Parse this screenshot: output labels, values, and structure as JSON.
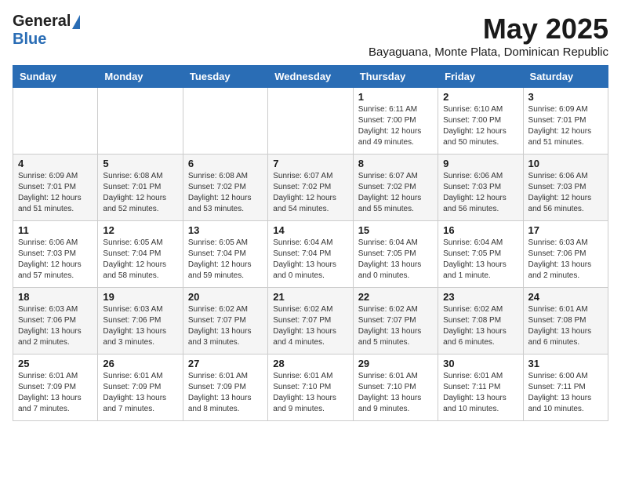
{
  "header": {
    "logo_general": "General",
    "logo_blue": "Blue",
    "title": "May 2025",
    "subtitle": "Bayaguana, Monte Plata, Dominican Republic"
  },
  "days_of_week": [
    "Sunday",
    "Monday",
    "Tuesday",
    "Wednesday",
    "Thursday",
    "Friday",
    "Saturday"
  ],
  "weeks": [
    [
      {
        "day": "",
        "info": ""
      },
      {
        "day": "",
        "info": ""
      },
      {
        "day": "",
        "info": ""
      },
      {
        "day": "",
        "info": ""
      },
      {
        "day": "1",
        "info": "Sunrise: 6:11 AM\nSunset: 7:00 PM\nDaylight: 12 hours\nand 49 minutes."
      },
      {
        "day": "2",
        "info": "Sunrise: 6:10 AM\nSunset: 7:00 PM\nDaylight: 12 hours\nand 50 minutes."
      },
      {
        "day": "3",
        "info": "Sunrise: 6:09 AM\nSunset: 7:01 PM\nDaylight: 12 hours\nand 51 minutes."
      }
    ],
    [
      {
        "day": "4",
        "info": "Sunrise: 6:09 AM\nSunset: 7:01 PM\nDaylight: 12 hours\nand 51 minutes."
      },
      {
        "day": "5",
        "info": "Sunrise: 6:08 AM\nSunset: 7:01 PM\nDaylight: 12 hours\nand 52 minutes."
      },
      {
        "day": "6",
        "info": "Sunrise: 6:08 AM\nSunset: 7:02 PM\nDaylight: 12 hours\nand 53 minutes."
      },
      {
        "day": "7",
        "info": "Sunrise: 6:07 AM\nSunset: 7:02 PM\nDaylight: 12 hours\nand 54 minutes."
      },
      {
        "day": "8",
        "info": "Sunrise: 6:07 AM\nSunset: 7:02 PM\nDaylight: 12 hours\nand 55 minutes."
      },
      {
        "day": "9",
        "info": "Sunrise: 6:06 AM\nSunset: 7:03 PM\nDaylight: 12 hours\nand 56 minutes."
      },
      {
        "day": "10",
        "info": "Sunrise: 6:06 AM\nSunset: 7:03 PM\nDaylight: 12 hours\nand 56 minutes."
      }
    ],
    [
      {
        "day": "11",
        "info": "Sunrise: 6:06 AM\nSunset: 7:03 PM\nDaylight: 12 hours\nand 57 minutes."
      },
      {
        "day": "12",
        "info": "Sunrise: 6:05 AM\nSunset: 7:04 PM\nDaylight: 12 hours\nand 58 minutes."
      },
      {
        "day": "13",
        "info": "Sunrise: 6:05 AM\nSunset: 7:04 PM\nDaylight: 12 hours\nand 59 minutes."
      },
      {
        "day": "14",
        "info": "Sunrise: 6:04 AM\nSunset: 7:04 PM\nDaylight: 13 hours\nand 0 minutes."
      },
      {
        "day": "15",
        "info": "Sunrise: 6:04 AM\nSunset: 7:05 PM\nDaylight: 13 hours\nand 0 minutes."
      },
      {
        "day": "16",
        "info": "Sunrise: 6:04 AM\nSunset: 7:05 PM\nDaylight: 13 hours\nand 1 minute."
      },
      {
        "day": "17",
        "info": "Sunrise: 6:03 AM\nSunset: 7:06 PM\nDaylight: 13 hours\nand 2 minutes."
      }
    ],
    [
      {
        "day": "18",
        "info": "Sunrise: 6:03 AM\nSunset: 7:06 PM\nDaylight: 13 hours\nand 2 minutes."
      },
      {
        "day": "19",
        "info": "Sunrise: 6:03 AM\nSunset: 7:06 PM\nDaylight: 13 hours\nand 3 minutes."
      },
      {
        "day": "20",
        "info": "Sunrise: 6:02 AM\nSunset: 7:07 PM\nDaylight: 13 hours\nand 3 minutes."
      },
      {
        "day": "21",
        "info": "Sunrise: 6:02 AM\nSunset: 7:07 PM\nDaylight: 13 hours\nand 4 minutes."
      },
      {
        "day": "22",
        "info": "Sunrise: 6:02 AM\nSunset: 7:07 PM\nDaylight: 13 hours\nand 5 minutes."
      },
      {
        "day": "23",
        "info": "Sunrise: 6:02 AM\nSunset: 7:08 PM\nDaylight: 13 hours\nand 6 minutes."
      },
      {
        "day": "24",
        "info": "Sunrise: 6:01 AM\nSunset: 7:08 PM\nDaylight: 13 hours\nand 6 minutes."
      }
    ],
    [
      {
        "day": "25",
        "info": "Sunrise: 6:01 AM\nSunset: 7:09 PM\nDaylight: 13 hours\nand 7 minutes."
      },
      {
        "day": "26",
        "info": "Sunrise: 6:01 AM\nSunset: 7:09 PM\nDaylight: 13 hours\nand 7 minutes."
      },
      {
        "day": "27",
        "info": "Sunrise: 6:01 AM\nSunset: 7:09 PM\nDaylight: 13 hours\nand 8 minutes."
      },
      {
        "day": "28",
        "info": "Sunrise: 6:01 AM\nSunset: 7:10 PM\nDaylight: 13 hours\nand 9 minutes."
      },
      {
        "day": "29",
        "info": "Sunrise: 6:01 AM\nSunset: 7:10 PM\nDaylight: 13 hours\nand 9 minutes."
      },
      {
        "day": "30",
        "info": "Sunrise: 6:01 AM\nSunset: 7:11 PM\nDaylight: 13 hours\nand 10 minutes."
      },
      {
        "day": "31",
        "info": "Sunrise: 6:00 AM\nSunset: 7:11 PM\nDaylight: 13 hours\nand 10 minutes."
      }
    ]
  ]
}
